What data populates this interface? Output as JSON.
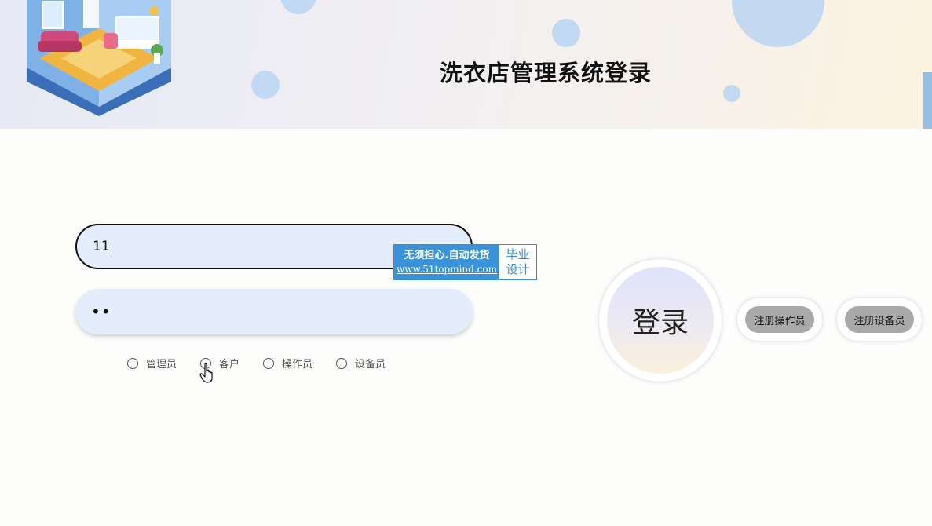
{
  "header": {
    "title": "洗衣店管理系统登录"
  },
  "form": {
    "username_value": "11",
    "password_mask": "••"
  },
  "roles": [
    {
      "label": "管理员"
    },
    {
      "label": "客户"
    },
    {
      "label": "操作员"
    },
    {
      "label": "设备员"
    }
  ],
  "buttons": {
    "login": "登录",
    "register_operator": "注册操作员",
    "register_equipment": "注册设备员"
  },
  "watermark": {
    "line1": "无须担心.自动发货",
    "line2": "www.51topmind.com",
    "right1": "毕业",
    "right2": "设计"
  },
  "colors": {
    "input_bg": "#e4edfb",
    "watermark_blue": "#3a93d8",
    "register_button_bg": "#a9a9a9"
  },
  "icons": [
    "room-illustration",
    "pointer-hand-cursor-icon"
  ]
}
